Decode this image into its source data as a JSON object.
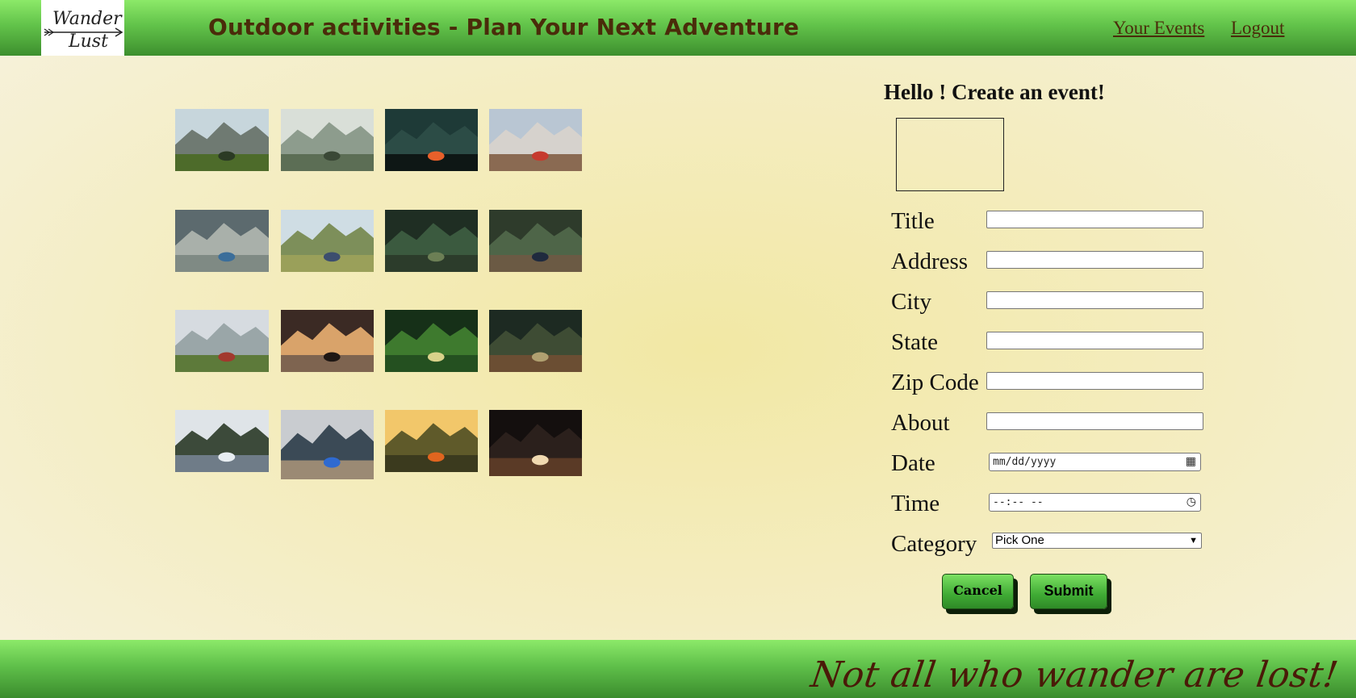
{
  "header": {
    "logo_alt": "Wander Lust",
    "title": "Outdoor activities - Plan Your Next Adventure",
    "nav": [
      {
        "label": "Your Events"
      },
      {
        "label": "Logout"
      }
    ]
  },
  "gallery": {
    "photos": [
      {
        "name": "yosemite-valley-photo"
      },
      {
        "name": "misty-forest-photo"
      },
      {
        "name": "kayak-lake-photo"
      },
      {
        "name": "mountain-tent-photo"
      },
      {
        "name": "river-rocks-photo"
      },
      {
        "name": "hikers-meadow-photo"
      },
      {
        "name": "forest-trail-photo"
      },
      {
        "name": "forest-log-walk-photo"
      },
      {
        "name": "mountain-hiker-photo"
      },
      {
        "name": "tent-view-photo"
      },
      {
        "name": "green-forest-photo"
      },
      {
        "name": "dark-woods-photo"
      },
      {
        "name": "kayak-bow-photo"
      },
      {
        "name": "blue-kayak-shore-photo"
      },
      {
        "name": "orange-tent-photo"
      },
      {
        "name": "campfire-photo"
      }
    ]
  },
  "form": {
    "heading": "Hello ! Create an event!",
    "fields": {
      "title": {
        "label": "Title",
        "value": ""
      },
      "address": {
        "label": "Address",
        "value": ""
      },
      "city": {
        "label": "City",
        "value": ""
      },
      "state": {
        "label": "State",
        "value": ""
      },
      "zip": {
        "label": "Zip Code",
        "value": ""
      },
      "about": {
        "label": "About",
        "value": ""
      },
      "date": {
        "label": "Date",
        "placeholder": "mm/dd/yyyy"
      },
      "time": {
        "label": "Time",
        "placeholder": "--:-- --"
      },
      "category": {
        "label": "Category",
        "selected": "Pick One"
      }
    },
    "cancel_label": "Cancel",
    "submit_label": "Submit"
  },
  "footer": {
    "tagline": "Not all who wander are lost!"
  }
}
